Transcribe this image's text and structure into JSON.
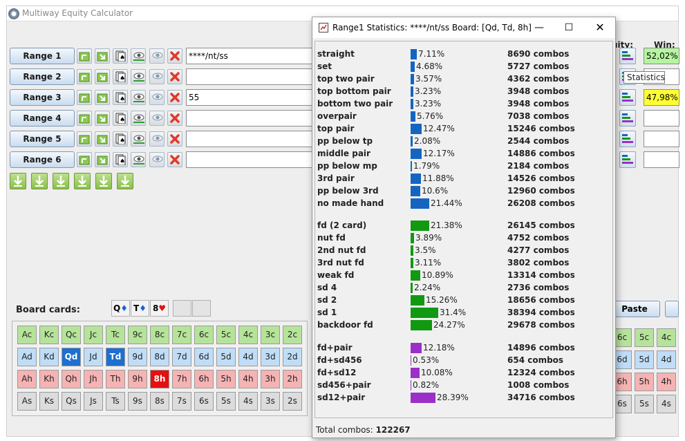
{
  "app": {
    "title": "Multiway Equity Calculator"
  },
  "ranges": [
    {
      "label": "Range 1",
      "value": "****/nt/ss"
    },
    {
      "label": "Range 2",
      "value": ""
    },
    {
      "label": "Range 3",
      "value": "55"
    },
    {
      "label": "Range 4",
      "value": ""
    },
    {
      "label": "Range 5",
      "value": ""
    },
    {
      "label": "Range 6",
      "value": ""
    }
  ],
  "right_headers": {
    "equity": "uity:",
    "win": "Win:"
  },
  "win_values": [
    "52,02%",
    "",
    "47,98%",
    "",
    "",
    ""
  ],
  "tooltip": "Statistics",
  "board": {
    "label": "Board cards:",
    "cards": [
      {
        "rank": "Q",
        "suit": "♦",
        "color": "#1e5fd8"
      },
      {
        "rank": "T",
        "suit": "♦",
        "color": "#1e5fd8"
      },
      {
        "rank": "8",
        "suit": "♥",
        "color": "#e51010"
      }
    ]
  },
  "paste_label": "Paste",
  "card_grid": {
    "rows": [
      {
        "suit": "c",
        "cards": [
          "Ac",
          "Kc",
          "Qc",
          "Jc",
          "Tc",
          "9c",
          "8c",
          "7c",
          "6c",
          "5c",
          "4c",
          "3c",
          "2c"
        ]
      },
      {
        "suit": "d",
        "cards": [
          "Ad",
          "Kd",
          "Qd",
          "Jd",
          "Td",
          "9d",
          "8d",
          "7d",
          "6d",
          "5d",
          "4d",
          "3d",
          "2d"
        ]
      },
      {
        "suit": "h",
        "cards": [
          "Ah",
          "Kh",
          "Qh",
          "Jh",
          "Th",
          "9h",
          "8h",
          "7h",
          "6h",
          "5h",
          "4h",
          "3h",
          "2h"
        ]
      },
      {
        "suit": "s",
        "cards": [
          "As",
          "Ks",
          "Qs",
          "Js",
          "Ts",
          "9s",
          "8s",
          "7s",
          "6s",
          "5s",
          "4s",
          "3s",
          "2s"
        ]
      }
    ],
    "selected": [
      "Qd",
      "Td",
      "8h"
    ]
  },
  "right_grid": {
    "rows": [
      [
        "6c",
        "5c",
        "4c"
      ],
      [
        "6d",
        "5d",
        "4d"
      ],
      [
        "6h",
        "5h",
        "4h"
      ],
      [
        "6s",
        "5s",
        "4s"
      ]
    ]
  },
  "dialog": {
    "title": "Range1 Statistics: ****/nt/ss Board: [Qd, Td, 8h]",
    "total_label": "Total combos:",
    "total_value": "122267",
    "bar_colors": {
      "made": "#1565c0",
      "draw": "#119911",
      "combo": "#9b30c9"
    },
    "groups": [
      {
        "color_key": "made",
        "rows": [
          {
            "label": "straight",
            "pct": 7.11,
            "pct_text": "7.11%",
            "combos": "8690 combos"
          },
          {
            "label": "set",
            "pct": 4.68,
            "pct_text": "4.68%",
            "combos": "5727 combos"
          },
          {
            "label": "top two pair",
            "pct": 3.57,
            "pct_text": "3.57%",
            "combos": "4362 combos"
          },
          {
            "label": "top bottom pair",
            "pct": 3.23,
            "pct_text": "3.23%",
            "combos": "3948 combos"
          },
          {
            "label": "bottom two pair",
            "pct": 3.23,
            "pct_text": "3.23%",
            "combos": "3948 combos"
          },
          {
            "label": "overpair",
            "pct": 5.76,
            "pct_text": "5.76%",
            "combos": "7038 combos"
          },
          {
            "label": "top pair",
            "pct": 12.47,
            "pct_text": "12.47%",
            "combos": "15246 combos"
          },
          {
            "label": "pp below tp",
            "pct": 2.08,
            "pct_text": "2.08%",
            "combos": "2544 combos"
          },
          {
            "label": "middle pair",
            "pct": 12.17,
            "pct_text": "12.17%",
            "combos": "14886 combos"
          },
          {
            "label": "pp below mp",
            "pct": 1.79,
            "pct_text": "1.79%",
            "combos": "2184 combos"
          },
          {
            "label": "3rd pair",
            "pct": 11.88,
            "pct_text": "11.88%",
            "combos": "14526 combos"
          },
          {
            "label": "pp below 3rd",
            "pct": 10.6,
            "pct_text": "10.6%",
            "combos": "12960 combos"
          },
          {
            "label": "no made hand",
            "pct": 21.44,
            "pct_text": "21.44%",
            "combos": "26208 combos"
          }
        ]
      },
      {
        "color_key": "draw",
        "rows": [
          {
            "label": "fd (2 card)",
            "pct": 21.38,
            "pct_text": "21.38%",
            "combos": "26145 combos"
          },
          {
            "label": "nut fd",
            "pct": 3.89,
            "pct_text": "3.89%",
            "combos": "4752 combos"
          },
          {
            "label": "2nd nut fd",
            "pct": 3.5,
            "pct_text": "3.5%",
            "combos": "4277 combos"
          },
          {
            "label": "3rd nut fd",
            "pct": 3.11,
            "pct_text": "3.11%",
            "combos": "3802 combos"
          },
          {
            "label": "weak fd",
            "pct": 10.89,
            "pct_text": "10.89%",
            "combos": "13314 combos"
          },
          {
            "label": "sd 4",
            "pct": 2.24,
            "pct_text": "2.24%",
            "combos": "2736 combos"
          },
          {
            "label": "sd 2",
            "pct": 15.26,
            "pct_text": "15.26%",
            "combos": "18656 combos"
          },
          {
            "label": "sd 1",
            "pct": 31.4,
            "pct_text": "31.4%",
            "combos": "38394 combos"
          },
          {
            "label": "backdoor fd",
            "pct": 24.27,
            "pct_text": "24.27%",
            "combos": "29678 combos"
          }
        ]
      },
      {
        "color_key": "combo",
        "rows": [
          {
            "label": "fd+pair",
            "pct": 12.18,
            "pct_text": "12.18%",
            "combos": "14896 combos"
          },
          {
            "label": "fd+sd456",
            "pct": 0.53,
            "pct_text": "0.53%",
            "combos": "654 combos"
          },
          {
            "label": "fd+sd12",
            "pct": 10.08,
            "pct_text": "10.08%",
            "combos": "12324 combos"
          },
          {
            "label": "sd456+pair",
            "pct": 0.82,
            "pct_text": "0.82%",
            "combos": "1008 combos"
          },
          {
            "label": "sd12+pair",
            "pct": 28.39,
            "pct_text": "28.39%",
            "combos": "34716 combos"
          }
        ]
      }
    ]
  }
}
